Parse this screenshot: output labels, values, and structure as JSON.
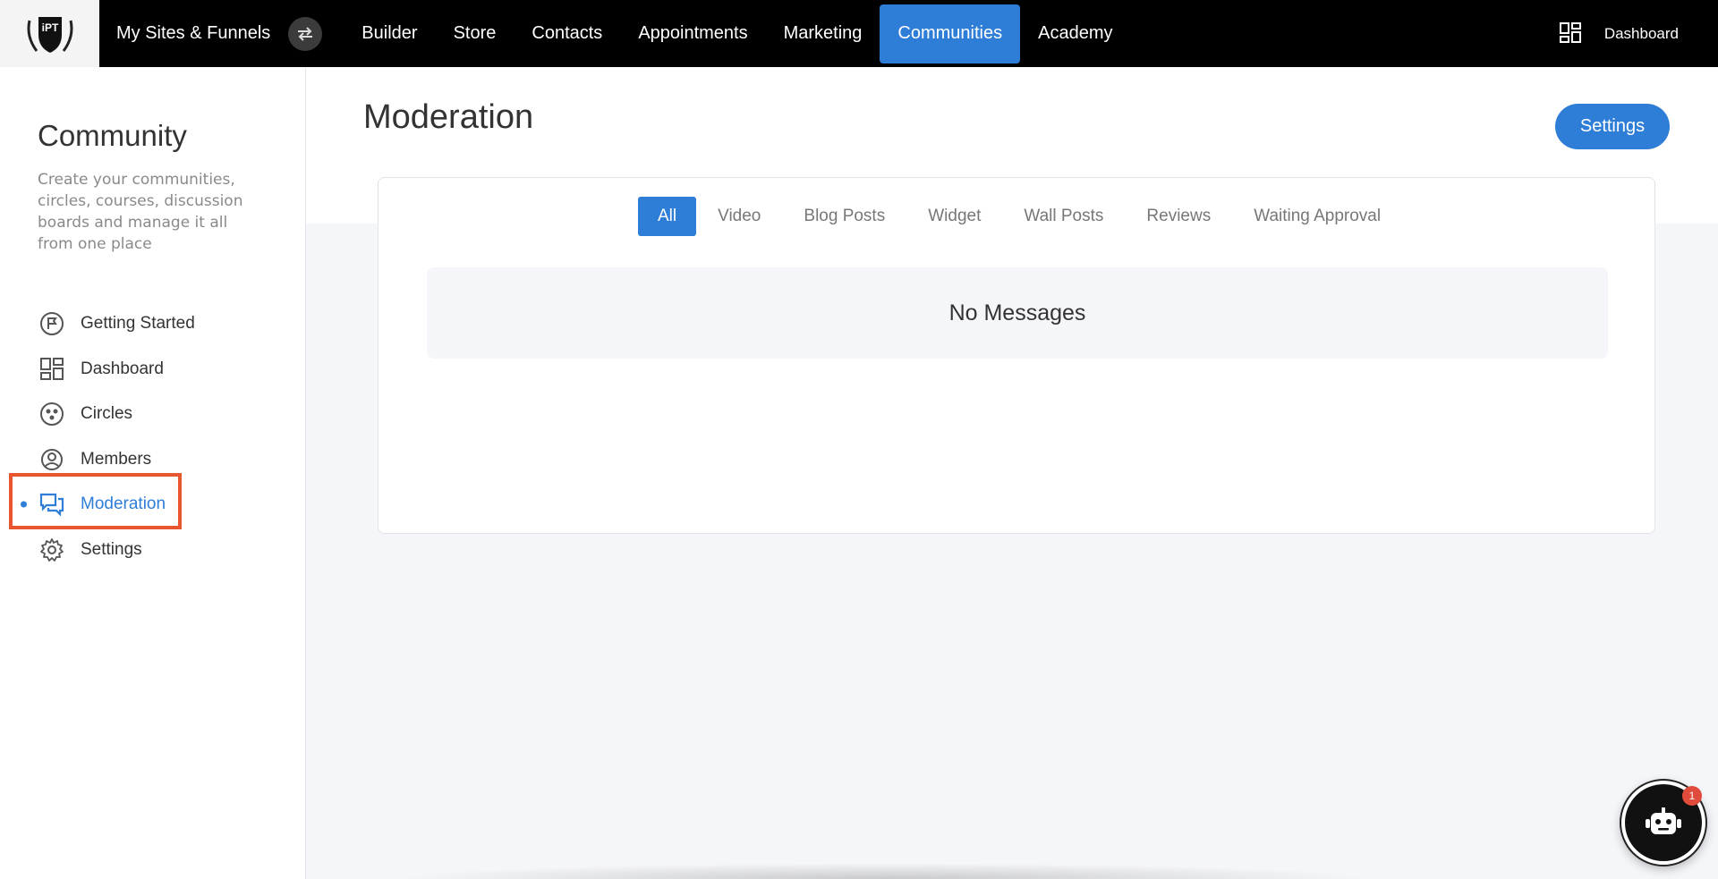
{
  "topbar": {
    "logo_text": "iPT",
    "site_switch_label": "My Sites & Funnels",
    "nav_items": [
      "Builder",
      "Store",
      "Contacts",
      "Appointments",
      "Marketing",
      "Communities",
      "Academy"
    ],
    "active_nav": "Communities",
    "dashboard_label": "Dashboard"
  },
  "sidebar": {
    "title": "Community",
    "description": "Create your communities, circles, courses, discussion boards and manage it all from one place",
    "items": [
      {
        "label": "Getting Started",
        "icon": "flag-icon"
      },
      {
        "label": "Dashboard",
        "icon": "dashboard-grid-icon"
      },
      {
        "label": "Circles",
        "icon": "circles-icon"
      },
      {
        "label": "Members",
        "icon": "user-circle-icon"
      },
      {
        "label": "Moderation",
        "icon": "chat-bubbles-icon"
      },
      {
        "label": "Settings",
        "icon": "gear-icon"
      }
    ],
    "active_item": "Moderation"
  },
  "main": {
    "title": "Moderation",
    "settings_button": "Settings",
    "tabs": [
      "All",
      "Video",
      "Blog Posts",
      "Widget",
      "Wall Posts",
      "Reviews",
      "Waiting Approval"
    ],
    "active_tab": "All",
    "empty_message": "No Messages"
  },
  "chatbot": {
    "badge_count": "1",
    "icon": "robot-icon"
  },
  "colors": {
    "accent": "#2e7dd7",
    "topbar_bg": "#000000",
    "highlight_border": "#e8562f",
    "badge": "#e04b3b"
  }
}
